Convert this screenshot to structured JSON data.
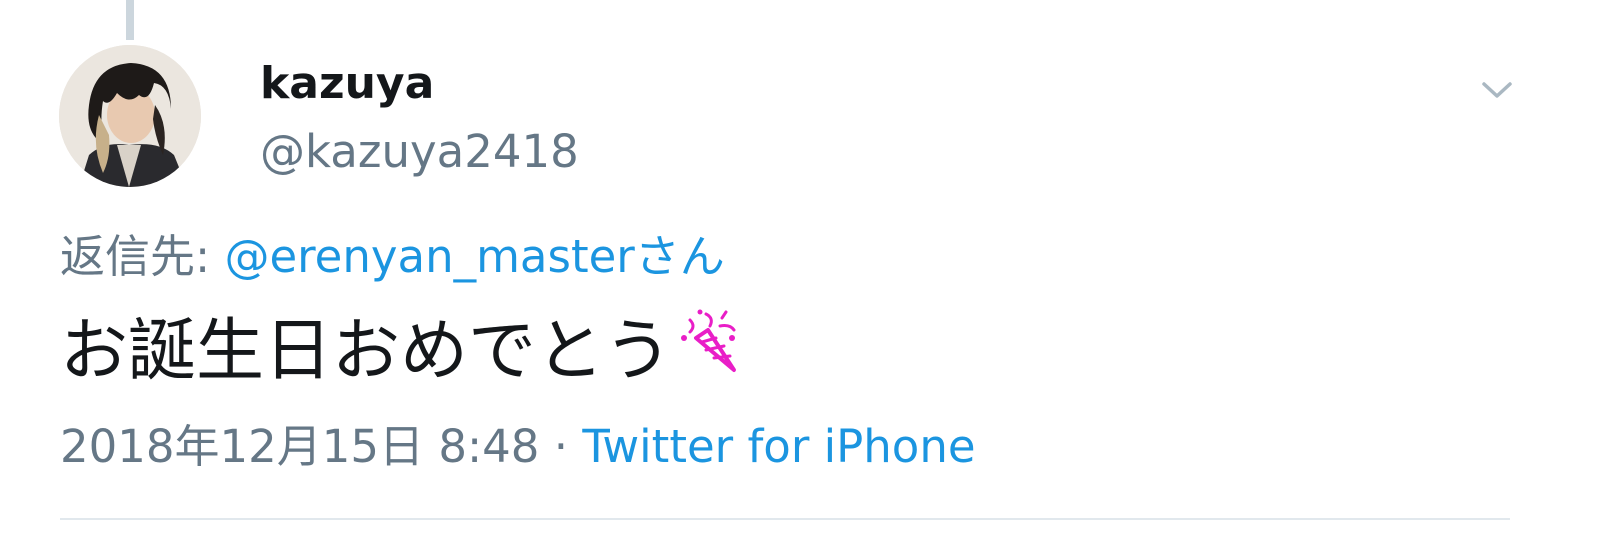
{
  "tweet": {
    "author": {
      "display_name": "kazuya",
      "handle": "@kazuya2418",
      "avatar_icon": "user-avatar-photo"
    },
    "menu_icon": "chevron-down-icon",
    "reply": {
      "prefix": "返信先: ",
      "to": "@erenyan_masterさん"
    },
    "text": "お誕生日おめでとう",
    "emoji_icon": "party-popper-icon",
    "timestamp": "2018年12月15日 8:48",
    "separator": " · ",
    "source": "Twitter for iPhone"
  },
  "colors": {
    "text_primary": "#14171a",
    "text_secondary": "#657786",
    "link": "#1b95e0",
    "emoji": "#e91ec7",
    "divider": "#e1e8ed"
  }
}
